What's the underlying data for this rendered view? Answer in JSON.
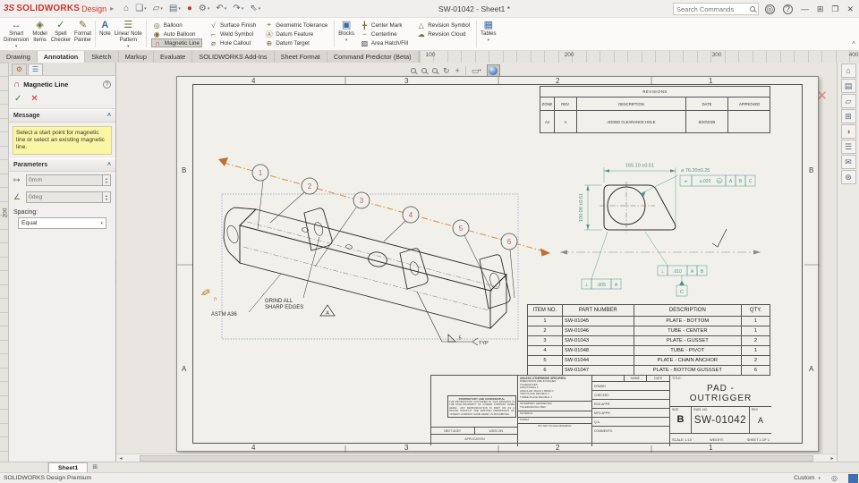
{
  "titlebar": {
    "logo_prefix": "3S",
    "logo_text": "SOLIDWORKS",
    "edition": "Design",
    "title": "SW-01042 - Sheet1 *",
    "search_placeholder": "Search Commands"
  },
  "icons": {
    "dd": "▾",
    "chevup": "˄",
    "collapse": "^",
    "splitter": "◂",
    "up": "▴",
    "down": "▾",
    "user": "◎",
    "help": "?",
    "min": "—",
    "grid": "⊞",
    "restore": "❐",
    "close": "✕",
    "magnet": "∩",
    "length": "↦",
    "angle": "∠",
    "pm_tab1": "⚙",
    "pm_tab2": "☰",
    "ok": "✓",
    "cancel": "✕",
    "pencil": "✎",
    "scroll_left": "◂",
    "scroll_right": "▸",
    "headsup": [
      "↻",
      "+",
      "▭",
      "▾"
    ]
  },
  "qat": [
    {
      "n": "home",
      "g": "⌂"
    },
    {
      "n": "new",
      "g": "❏"
    },
    {
      "n": "open",
      "g": "▱"
    },
    {
      "n": "save",
      "g": "▤"
    },
    {
      "n": "publish",
      "g": "●"
    },
    {
      "n": "settings",
      "g": "⚙"
    },
    {
      "n": "undo",
      "g": "↶"
    },
    {
      "n": "redo",
      "g": "↷"
    },
    {
      "n": "select",
      "g": "⇖"
    }
  ],
  "ribbon": {
    "buttons": [
      {
        "label": "Smart\nDimension",
        "glyph": "↔"
      },
      {
        "label": "Model\nItems",
        "glyph": "◈"
      },
      {
        "label": "Spell\nChecker",
        "glyph": "✓"
      },
      {
        "label": "Format\nPainter",
        "glyph": "✎"
      },
      {
        "label": "Note",
        "glyph": "A"
      },
      {
        "label": "Linear Note\nPattern",
        "glyph": "☰"
      },
      {
        "label": "Balloon",
        "glyph": "◎"
      },
      {
        "label": "Auto Balloon",
        "glyph": "◉"
      },
      {
        "label": "Magnetic Line",
        "glyph": "∩"
      },
      {
        "label": "Surface Finish",
        "glyph": "√"
      },
      {
        "label": "Weld Symbol",
        "glyph": "⌐"
      },
      {
        "label": "Hole Callout",
        "glyph": "⌀"
      },
      {
        "label": "Geometric Tolerance",
        "glyph": "⌖"
      },
      {
        "label": "Datum Feature",
        "glyph": "Ⓐ"
      },
      {
        "label": "Datum Target",
        "glyph": "⊕"
      },
      {
        "label": "Blocks",
        "glyph": "▣"
      },
      {
        "label": "Center Mark",
        "glyph": "╋"
      },
      {
        "label": "Centerline",
        "glyph": "┄"
      },
      {
        "label": "Area Hatch/Fill",
        "glyph": "▨"
      },
      {
        "label": "Revision Symbol",
        "glyph": "△"
      },
      {
        "label": "Revision Cloud",
        "glyph": "☁"
      },
      {
        "label": "Tables",
        "glyph": "▦"
      }
    ]
  },
  "tabs": [
    "Drawing",
    "Annotation",
    "Sketch",
    "Markup",
    "Evaluate",
    "SOLIDWORKS Add-Ins",
    "Sheet Format",
    "Command Predictor (Beta)"
  ],
  "ruler": {
    "h": [
      "100",
      "200",
      "300",
      "400"
    ],
    "v": "200"
  },
  "pm": {
    "title": "Magnetic Line",
    "message_header": "Message",
    "message": "Select a start point for magnetic line or select an existing magnetic line.",
    "parameters_header": "Parameters",
    "length_value": "0mm",
    "angle_value": "0deg",
    "spacing_label": "Spacing:",
    "spacing_value": "Equal"
  },
  "sheet": {
    "zones_cols": [
      "4",
      "3",
      "2",
      "1"
    ],
    "zones_rows": [
      "B",
      "A"
    ],
    "revisions": {
      "title": "REVISIONS",
      "headers": [
        "ZONE",
        "REV.",
        "DESCRIPTION",
        "DATE",
        "APPROVED"
      ],
      "row": {
        "zone": "A4",
        "rev": "A",
        "description": "ADDED CLEARANCE HOLE",
        "date": "8/20/2025",
        "approved": ""
      }
    },
    "balloons": [
      "1",
      "2",
      "3",
      "4",
      "5",
      "6"
    ],
    "notes": {
      "material": "ASTM A36",
      "grind1": "GRIND ALL",
      "grind2": "SHARP EDGES",
      "flag": "A",
      "weld_size": ".5",
      "weld_typ": "TYP"
    },
    "detail": {
      "dim_w": "165.10 ±0.51",
      "dim_h": "100.08 ±0.51",
      "hole": "⌀ 76.20±0.25",
      "fcf_pos": {
        "s": "⌖",
        "t": "⌀.020",
        "m": "M",
        "d1": "A",
        "d2": "B",
        "d3": "C"
      },
      "fcf_a": {
        "s": "⊥",
        "t": ".005",
        "d1": "A"
      },
      "fcf_b": {
        "s": "⊥",
        "t": ".010",
        "d1": "A",
        "d2": "B"
      },
      "datum": "C"
    },
    "bom": {
      "headers": [
        "ITEM NO.",
        "PART NUMBER",
        "DESCRIPTION",
        "QTY."
      ],
      "rows": [
        [
          "1",
          "SW-01045",
          "PLATE - BOTTOM",
          "1"
        ],
        [
          "2",
          "SW-01046",
          "TUBE - CENTER",
          "1"
        ],
        [
          "3",
          "SW-01043",
          "PLATE - GUSSET",
          "2"
        ],
        [
          "4",
          "SW-01048",
          "TUBE - PIVOT",
          "1"
        ],
        [
          "5",
          "SW-01044",
          "PLATE - CHAIN ANCHOR",
          "2"
        ],
        [
          "6",
          "SW-01047",
          "PLATE - BOTTOM GUSSSET",
          "6"
        ]
      ]
    },
    "tblock": {
      "proprietary_title": "PROPRIETARY AND CONFIDENTIAL",
      "proprietary_body": "THE INFORMATION CONTAINED IN THIS DRAWING IS THE SOLE PROPERTY OF <INSERT COMPANY NAME HERE>. ANY REPRODUCTION IN PART OR AS A WHOLE WITHOUT THE WRITTEN PERMISSION OF <INSERT COMPANY NAME HERE> IS PROHIBITED.",
      "next_assy": "NEXT ASSY",
      "used_on": "USED ON",
      "application": "APPLICATION",
      "spec_title": "UNLESS OTHERWISE SPECIFIED:",
      "spec_body": "DIMENSIONS ARE IN INCHES\nTOLERANCES:\nFRACTIONAL ±\nANGULAR: MACH ±   BEND ±\nTWO PLACE DECIMAL    ±\nTHREE PLACE DECIMAL  ±",
      "interpret": "INTERPRET GEOMETRIC\nTOLERANCING PER:",
      "material": "MATERIAL",
      "finish": "FINISH",
      "dns": "DO NOT SCALE DRAWING",
      "name": "NAME",
      "date": "DATE",
      "rows": [
        "DRAWN",
        "CHECKED",
        "ENG APPR.",
        "MFG APPR.",
        "Q.A.",
        "COMMENTS:"
      ],
      "title_label": "TITLE:",
      "title": "PAD -\nOUTRIGGER",
      "size_label": "SIZE",
      "size": "B",
      "dwg_label": "DWG. NO.",
      "dwg": "SW-01042",
      "rev_label": "REV",
      "rev": "A",
      "scale": "SCALE: 1:10",
      "weight": "WEIGHT:",
      "sheet_of": "SHEET 1 OF 1"
    }
  },
  "taskpane": [
    {
      "n": "solidworks-resources",
      "g": "⌂"
    },
    {
      "n": "design-library",
      "g": "▤"
    },
    {
      "n": "file-explorer",
      "g": "▱"
    },
    {
      "n": "view-palette",
      "g": "⊞"
    },
    {
      "n": "appearances",
      "g": "◑"
    },
    {
      "n": "custom-properties",
      "g": "☰"
    },
    {
      "n": "solidworks-forum",
      "g": "✉"
    },
    {
      "n": "3dexperience",
      "g": "⊛"
    }
  ],
  "sheettabs": {
    "sheet1": "Sheet1"
  },
  "statusbar": {
    "left": "SOLIDWORKS Design Premium",
    "unit": "Custom"
  }
}
